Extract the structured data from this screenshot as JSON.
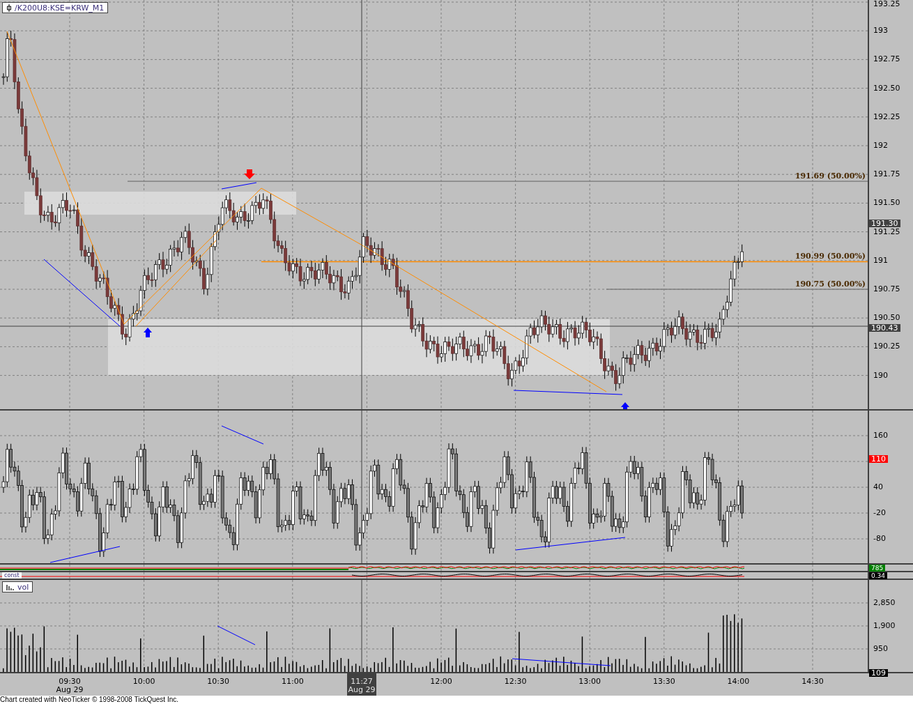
{
  "symbol": {
    "label": "/K200U8:KSE=KRW_M1"
  },
  "price_panel": {
    "ticks": [
      "193.25",
      "193",
      "192.75",
      "192.50",
      "192.25",
      "192",
      "191.75",
      "191.50",
      "191.25",
      "191",
      "190.75",
      "190.50",
      "190.25",
      "190"
    ],
    "levels": [
      {
        "label": "191.69 (50.00%)",
        "color": "#808080"
      },
      {
        "label": "190.99 (50.00%)",
        "color": "#ff8c00"
      },
      {
        "label": "190.75 (50.00%)",
        "color": "#808080"
      }
    ],
    "markers": [
      {
        "text": "191.30",
        "color": "#404040"
      },
      {
        "text": "190.43",
        "color": "#404040"
      }
    ]
  },
  "oscillator_panel": {
    "ticks": [
      "160",
      "40",
      "-20",
      "-80"
    ],
    "markers": [
      {
        "text": "110",
        "color": "#ff0000"
      }
    ]
  },
  "line_panel": {
    "markers": [
      {
        "text": "785",
        "color": "#008000"
      }
    ]
  },
  "const_panel": {
    "label": "const",
    "markers": [
      {
        "text": "0.34",
        "color": "#000000"
      }
    ]
  },
  "volume_panel": {
    "label": "vol",
    "ticks": [
      "2,850",
      "1,900",
      "950"
    ],
    "markers": [
      {
        "text": "109",
        "color": "#000000"
      }
    ]
  },
  "time_axis": {
    "ticks": [
      {
        "time": "09:30",
        "date": "Aug 29"
      },
      {
        "time": "10:00"
      },
      {
        "time": "10:30"
      },
      {
        "time": "11:00"
      },
      {
        "time": "12:00"
      },
      {
        "time": "12:30"
      },
      {
        "time": "13:00"
      },
      {
        "time": "13:30"
      },
      {
        "time": "14:00"
      },
      {
        "time": "14:30"
      }
    ],
    "cursor": {
      "time": "11:27",
      "date": "Aug 29"
    }
  },
  "footer": "Chart created with NeoTicker © 1998-2008 TickQuest Inc."
}
